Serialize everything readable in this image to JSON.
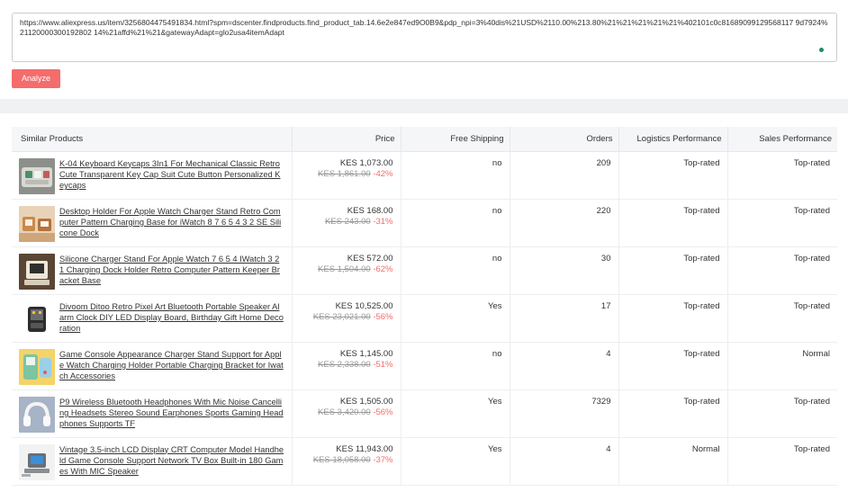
{
  "input": {
    "url": "https://www.aliexpress.us/item/3256804475491834.html?spm=dscenter.findproducts.find_product_tab.14.6e2e847ed9O0B9&pdp_npi=3%40dis%21USD%2110.00%213.80%21%21%21%21%21%402101c0c81689099129568117 9d7924%21120000300192802 14%21affd%21%21&gatewayAdapt=glo2usa4itemAdapt"
  },
  "analyze_label": "Analyze",
  "table": {
    "headers": {
      "product": "Similar Products",
      "price": "Price",
      "shipping": "Free Shipping",
      "orders": "Orders",
      "logistics": "Logistics Performance",
      "sales": "Sales Performance"
    },
    "rows": [
      {
        "title": "K-04 Keyboard Keycaps 3In1 For Mechanical Classic Retro Cute Transparent Key Cap Suit Cute Button Personalized Keycaps",
        "price": "KES 1,073.00",
        "old_price": "KES 1,861.00",
        "discount": "-42%",
        "shipping": "no",
        "orders": "209",
        "logistics": "Top-rated",
        "sales": "Top-rated",
        "thumb_icon": "keycaps-thumbnail"
      },
      {
        "title": "Desktop Holder For Apple Watch Charger Stand Retro Computer Pattern Charging Base for iWatch 8 7 6 5 4 3 2 SE Silicone Dock",
        "price": "KES 168.00",
        "old_price": "KES 243.00",
        "discount": "-31%",
        "shipping": "no",
        "orders": "220",
        "logistics": "Top-rated",
        "sales": "Top-rated",
        "thumb_icon": "watch-stand-thumbnail"
      },
      {
        "title": "Silicone Charger Stand For Apple Watch 7 6 5 4 IWatch 3 2 1 Charging Dock Holder Retro Computer Pattern Keeper Bracket Base",
        "price": "KES 572.00",
        "old_price": "KES 1,504.00",
        "discount": "-62%",
        "shipping": "no",
        "orders": "30",
        "logistics": "Top-rated",
        "sales": "Top-rated",
        "thumb_icon": "charger-dock-thumbnail"
      },
      {
        "title": "Divoom Ditoo Retro Pixel Art Bluetooth Portable Speaker Alarm Clock DIY LED Display Board, Birthday Gift Home Decoration",
        "price": "KES 10,525.00",
        "old_price": "KES 23,021.00",
        "discount": "-56%",
        "shipping": "Yes",
        "orders": "17",
        "logistics": "Top-rated",
        "sales": "Top-rated",
        "thumb_icon": "speaker-thumbnail"
      },
      {
        "title": "Game Console Appearance Charger Stand Support for Apple Watch Charging Holder Portable Charging Bracket for Iwatch Accessories",
        "price": "KES 1,145.00",
        "old_price": "KES 2,338.00",
        "discount": "-51%",
        "shipping": "no",
        "orders": "4",
        "logistics": "Top-rated",
        "sales": "Normal",
        "thumb_icon": "game-console-stand-thumbnail"
      },
      {
        "title": "P9 Wireless Bluetooth Headphones With Mic Noise Cancelling Headsets Stereo Sound Earphones Sports Gaming Headphones Supports TF",
        "price": "KES 1,505.00",
        "old_price": "KES 3,420.00",
        "discount": "-56%",
        "shipping": "Yes",
        "orders": "7329",
        "logistics": "Top-rated",
        "sales": "Top-rated",
        "thumb_icon": "headphones-thumbnail"
      },
      {
        "title": "Vintage 3.5-inch LCD Display CRT Computer Model Handheld Game Console Support Network TV Box Built-in 180 Games With MIC Speaker",
        "price": "KES 11,943.00",
        "old_price": "KES 18,058.00",
        "discount": "-37%",
        "shipping": "Yes",
        "orders": "4",
        "logistics": "Normal",
        "sales": "Top-rated",
        "thumb_icon": "crt-console-thumbnail"
      }
    ]
  }
}
